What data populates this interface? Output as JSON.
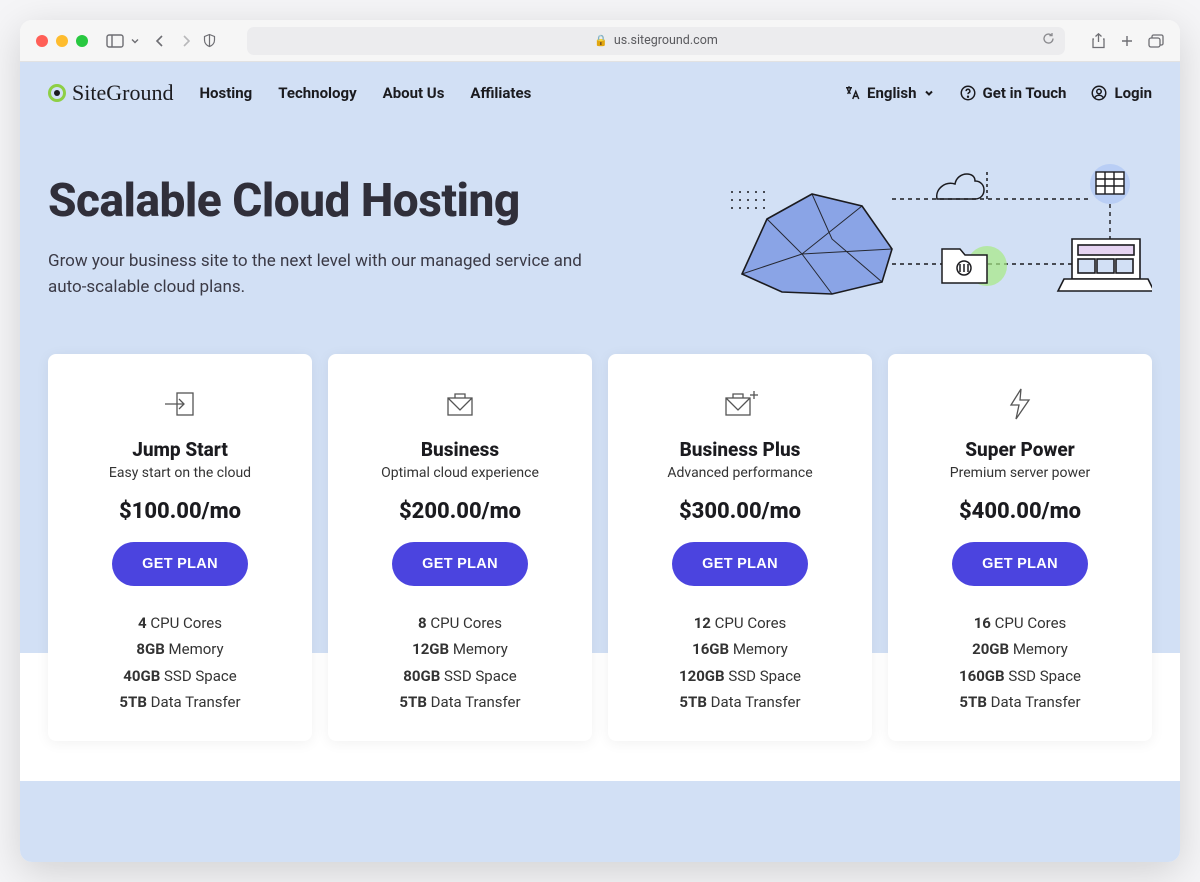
{
  "browser": {
    "url": "us.siteground.com"
  },
  "nav": {
    "logo": "SiteGround",
    "links": [
      "Hosting",
      "Technology",
      "About Us",
      "Affiliates"
    ],
    "language": "English",
    "touch": "Get in Touch",
    "login": "Login"
  },
  "hero": {
    "title": "Scalable Cloud Hosting",
    "subtitle": "Grow your business site to the next level with our managed service and auto-scalable cloud plans."
  },
  "cta": "GET PLAN",
  "plans": [
    {
      "name": "Jump Start",
      "sub": "Easy start on the cloud",
      "price": "$100.00/mo",
      "features": [
        {
          "b": "4",
          "t": " CPU Cores"
        },
        {
          "b": "8GB",
          "t": " Memory"
        },
        {
          "b": "40GB",
          "t": " SSD Space"
        },
        {
          "b": "5TB",
          "t": " Data Transfer"
        }
      ]
    },
    {
      "name": "Business",
      "sub": "Optimal cloud experience",
      "price": "$200.00/mo",
      "features": [
        {
          "b": "8",
          "t": " CPU Cores"
        },
        {
          "b": "12GB",
          "t": " Memory"
        },
        {
          "b": "80GB",
          "t": " SSD Space"
        },
        {
          "b": "5TB",
          "t": " Data Transfer"
        }
      ]
    },
    {
      "name": "Business Plus",
      "sub": "Advanced performance",
      "price": "$300.00/mo",
      "features": [
        {
          "b": "12",
          "t": " CPU Cores"
        },
        {
          "b": "16GB",
          "t": " Memory"
        },
        {
          "b": "120GB",
          "t": " SSD Space"
        },
        {
          "b": "5TB",
          "t": " Data Transfer"
        }
      ]
    },
    {
      "name": "Super Power",
      "sub": "Premium server power",
      "price": "$400.00/mo",
      "features": [
        {
          "b": "16",
          "t": " CPU Cores"
        },
        {
          "b": "20GB",
          "t": " Memory"
        },
        {
          "b": "160GB",
          "t": " SSD Space"
        },
        {
          "b": "5TB",
          "t": " Data Transfer"
        }
      ]
    }
  ]
}
